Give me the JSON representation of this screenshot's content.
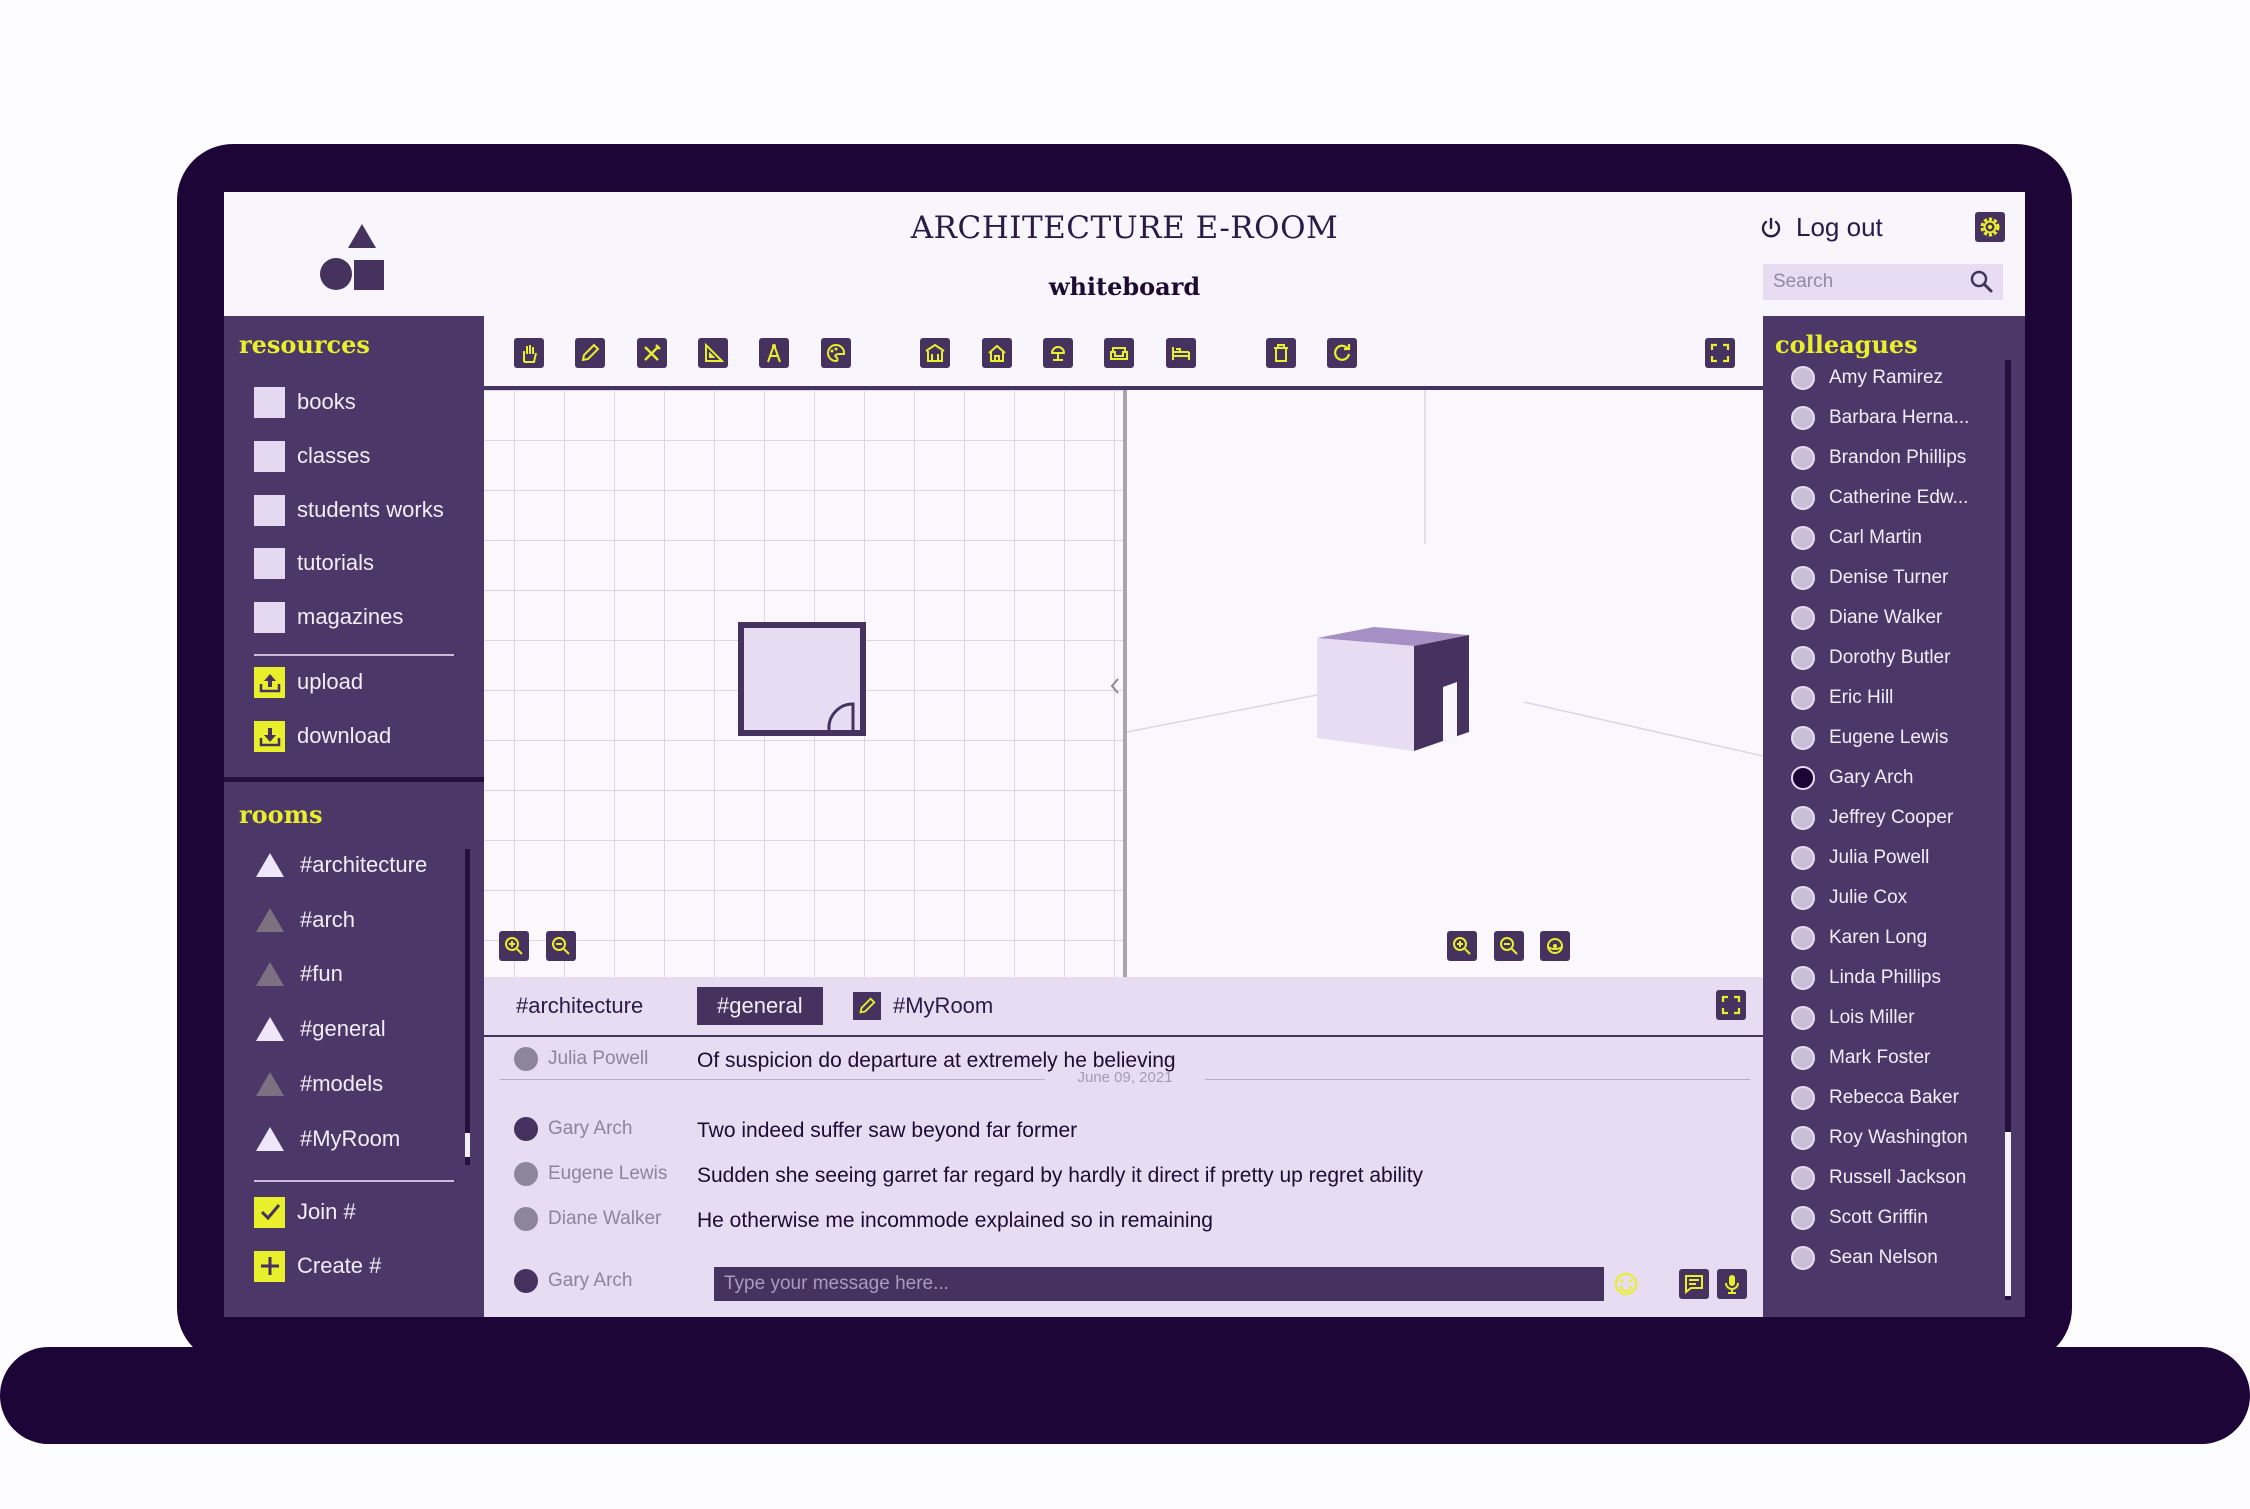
{
  "header": {
    "title": "ARCHITECTURE E-ROOM",
    "subtitle": "whiteboard",
    "logout_label": "Log out",
    "search_placeholder": "Search"
  },
  "resources": {
    "title": "resources",
    "items": [
      {
        "label": "books",
        "icon": "folder-square-icon"
      },
      {
        "label": "classes",
        "icon": "folder-square-icon"
      },
      {
        "label": "students works",
        "icon": "folder-square-icon"
      },
      {
        "label": "tutorials",
        "icon": "folder-square-icon"
      },
      {
        "label": "magazines",
        "icon": "folder-square-icon"
      }
    ],
    "upload_label": "upload",
    "download_label": "download"
  },
  "rooms": {
    "title": "rooms",
    "items": [
      {
        "label": "#architecture",
        "active": true
      },
      {
        "label": "#arch",
        "active": false
      },
      {
        "label": "#fun",
        "active": false
      },
      {
        "label": "#general",
        "active": true
      },
      {
        "label": "#models",
        "active": false
      },
      {
        "label": "#MyRoom",
        "active": true
      }
    ],
    "join_label": "Join #",
    "create_label": "Create #"
  },
  "toolbar": {
    "tools": [
      "hand-icon",
      "pencil-icon",
      "tools-icon",
      "set-square-icon",
      "compass-icon",
      "palette-icon"
    ],
    "elements": [
      "building-icon",
      "house-icon",
      "lamp-icon",
      "sofa-icon",
      "bed-icon"
    ],
    "actions": [
      "trash-icon",
      "rotate-icon"
    ],
    "fullscreen_icon": "fullscreen-icon"
  },
  "chat": {
    "tabs": [
      {
        "label": "#architecture",
        "active": false
      },
      {
        "label": "#general",
        "active": true
      },
      {
        "label": "#MyRoom",
        "active": false
      }
    ],
    "messages_before": [
      {
        "user": "Julia Powell",
        "text": "Of suspicion do departure at extremely he believing"
      }
    ],
    "date_divider": "June 09, 2021",
    "messages_after": [
      {
        "user": "Gary Arch",
        "text": "Two indeed suffer saw beyond far former"
      },
      {
        "user": "Eugene Lewis",
        "text": "Sudden she seeing garret far regard by hardly it direct if pretty up regret ability"
      },
      {
        "user": "Diane Walker",
        "text": "He otherwise me incommode explained so in remaining"
      }
    ],
    "current_user": "Gary Arch",
    "input_placeholder": "Type your message here..."
  },
  "colleagues": {
    "title": "colleagues",
    "items": [
      "Amy Ramirez",
      "Barbara Herna...",
      "Brandon Phillips",
      "Catherine Edw...",
      "Carl Martin",
      "Denise Turner",
      "Diane Walker",
      "Dorothy Butler",
      "Eric Hill",
      "Eugene Lewis",
      "Gary Arch",
      "Jeffrey Cooper",
      "Julia Powell",
      "Julie Cox",
      "Karen Long",
      "Linda Phillips",
      "Lois Miller",
      "Mark Foster",
      "Rebecca Baker",
      "Roy Washington",
      "Russell Jackson",
      "Scott Griffin",
      "Sean Nelson"
    ]
  },
  "colors": {
    "accent": "#e9ef2a",
    "panel": "#4b3868",
    "dark": "#1e0537",
    "light": "#e8dcf3"
  }
}
